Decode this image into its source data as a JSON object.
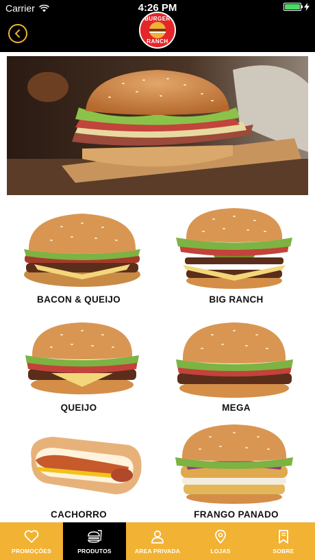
{
  "status_bar": {
    "carrier": "Carrier",
    "time": "4:26 PM"
  },
  "nav": {
    "logo_top": "BURGER",
    "logo_bottom": "RANCH"
  },
  "products": [
    {
      "name": "BACON & QUEIJO"
    },
    {
      "name": "BIG RANCH"
    },
    {
      "name": "QUEIJO"
    },
    {
      "name": "MEGA"
    },
    {
      "name": "CACHORRO"
    },
    {
      "name": "FRANGO PANADO"
    }
  ],
  "tabs": [
    {
      "label": "PROMOÇÕES",
      "icon": "heart-icon",
      "active": false
    },
    {
      "label": "PRODUTOS",
      "icon": "food-icon",
      "active": true
    },
    {
      "label": "AREA PRIVADA",
      "icon": "person-icon",
      "active": false
    },
    {
      "label": "LOJAS",
      "icon": "location-pin-icon",
      "active": false
    },
    {
      "label": "SOBRE",
      "icon": "bookmark-icon",
      "active": false
    }
  ],
  "colors": {
    "accent": "#f2b233",
    "bar": "#000000",
    "logo_red": "#e4262a"
  }
}
